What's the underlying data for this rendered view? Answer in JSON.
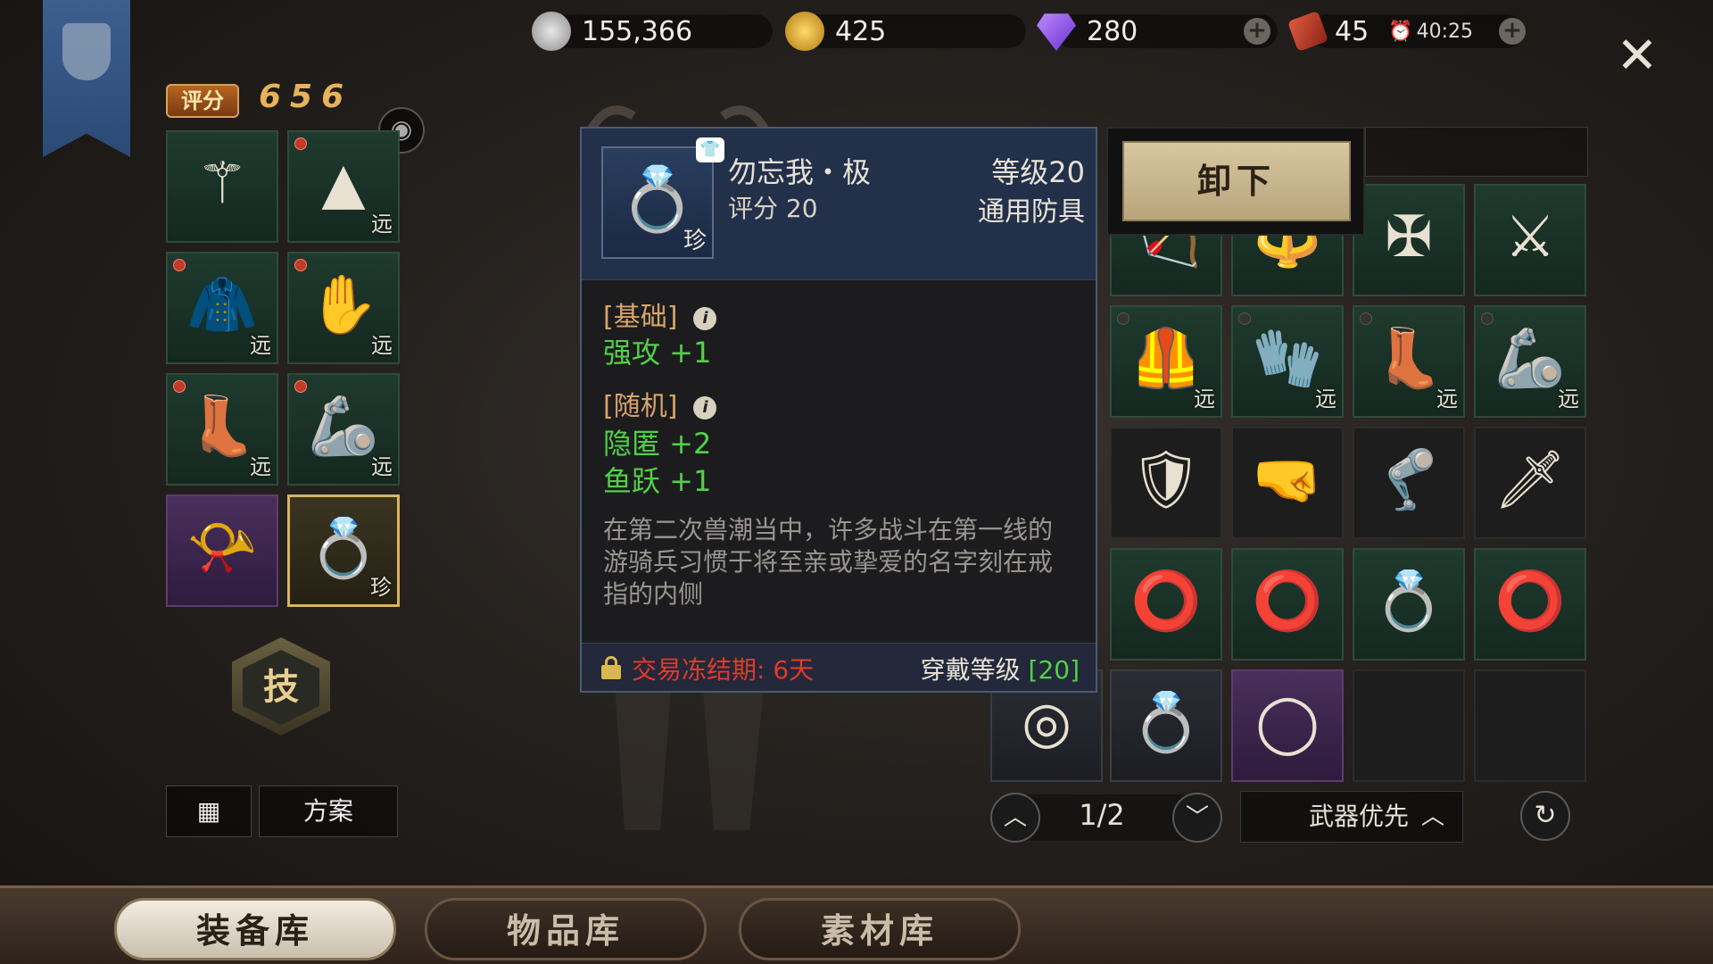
{
  "currency": {
    "silver": "155,366",
    "gold": "425",
    "diamond": "280",
    "stamina": "45",
    "timer": "40:25"
  },
  "score": {
    "label": "评分",
    "value": "656"
  },
  "equipped": [
    {
      "icon": "staff-icon",
      "glyph": "⚚",
      "tag": "",
      "dot": false,
      "style": "green"
    },
    {
      "icon": "hood-icon",
      "glyph": "▲",
      "tag": "远",
      "dot": true,
      "style": "green"
    },
    {
      "icon": "chest-armor-icon",
      "glyph": "🧥",
      "tag": "远",
      "dot": true,
      "style": "green"
    },
    {
      "icon": "gloves-icon",
      "glyph": "✋",
      "tag": "远",
      "dot": true,
      "style": "green"
    },
    {
      "icon": "boots-icon",
      "glyph": "👢",
      "tag": "远",
      "dot": true,
      "style": "green"
    },
    {
      "icon": "bracer-icon",
      "glyph": "🦾",
      "tag": "远",
      "dot": true,
      "style": "green"
    },
    {
      "icon": "horn-necklace-icon",
      "glyph": "📯",
      "tag": "",
      "dot": false,
      "style": "purple"
    },
    {
      "icon": "ring-icon",
      "glyph": "💍",
      "tag": "珍",
      "dot": false,
      "style": "gold"
    }
  ],
  "skill_label": "技",
  "plan_label": "方案",
  "tooltip": {
    "name": "勿忘我・极",
    "score": "评分 20",
    "level": "等级20",
    "type": "通用防具",
    "rarity_tag": "珍",
    "section_basic": "[基础]",
    "attr_basic": "强攻 +1",
    "section_random": "[随机]",
    "attr_random_1": "隐匿  +2",
    "attr_random_2": "鱼跃 +1",
    "description": "在第二次兽潮当中，许多战斗在第一线的游骑兵习惯于将至亲或挚爱的名字刻在戒指的内侧",
    "freeze": "交易冻结期: 6天",
    "wear_label": "穿戴等级 ",
    "wear_level": "[20]"
  },
  "unequip_label": "卸下",
  "inventory": [
    {
      "icon": "bow-icon",
      "glyph": "🏹",
      "tag": "",
      "style": "green",
      "dot": false
    },
    {
      "icon": "scepter-icon",
      "glyph": "🔱",
      "tag": "",
      "style": "green",
      "dot": false
    },
    {
      "icon": "cross-staff-icon",
      "glyph": "✠",
      "tag": "",
      "style": "green",
      "dot": false
    },
    {
      "icon": "halberd-icon",
      "glyph": "⚔",
      "tag": "",
      "style": "green",
      "dot": false
    },
    {
      "icon": "leather-vest-icon",
      "glyph": "🦺",
      "tag": "远",
      "style": "green",
      "dot": true
    },
    {
      "icon": "leather-gloves-icon",
      "glyph": "🧤",
      "tag": "远",
      "style": "green",
      "dot": true
    },
    {
      "icon": "leather-boots-icon",
      "glyph": "👢",
      "tag": "远",
      "style": "green",
      "dot": true
    },
    {
      "icon": "leather-bracer-icon",
      "glyph": "🦾",
      "tag": "远",
      "style": "green",
      "dot": true
    },
    {
      "icon": "plate-armor-icon",
      "glyph": "🛡",
      "tag": "",
      "style": "dark",
      "dot": false
    },
    {
      "icon": "plate-gauntlet-icon",
      "glyph": "🤜",
      "tag": "",
      "style": "dark",
      "dot": false
    },
    {
      "icon": "plate-greaves-icon",
      "glyph": "🦿",
      "tag": "",
      "style": "dark",
      "dot": false
    },
    {
      "icon": "plate-vambrace-icon",
      "glyph": "🗡",
      "tag": "",
      "style": "dark",
      "dot": false
    },
    {
      "icon": "silver-ring-icon",
      "glyph": "⭕",
      "tag": "",
      "style": "green",
      "dot": false
    },
    {
      "icon": "silver-ring-icon",
      "glyph": "⭕",
      "tag": "",
      "style": "green",
      "dot": false
    },
    {
      "icon": "sapphire-ring-icon",
      "glyph": "💍",
      "tag": "",
      "style": "green",
      "dot": false
    },
    {
      "icon": "ruby-band-icon",
      "glyph": "⭕",
      "tag": "",
      "style": "green",
      "dot": false
    },
    {
      "icon": "jade-bangle-icon",
      "glyph": "◯",
      "tag": "",
      "style": "purple",
      "dot": false
    },
    {
      "icon": "empty-slot",
      "glyph": "",
      "tag": "",
      "style": "dark",
      "dot": false
    },
    {
      "icon": "empty-slot",
      "glyph": "",
      "tag": "",
      "style": "dark",
      "dot": false
    }
  ],
  "extra_ring_left": {
    "icon": "pearl-ring-icon",
    "glyph": "◎"
  },
  "extra_ring_mid": {
    "icon": "amethyst-ring-icon",
    "glyph": "💍"
  },
  "pager": {
    "page": "1/2"
  },
  "sort_label": "武器优先",
  "tabs": [
    {
      "label": "装备库",
      "active": true
    },
    {
      "label": "物品库",
      "active": false
    },
    {
      "label": "素材库",
      "active": false
    }
  ]
}
